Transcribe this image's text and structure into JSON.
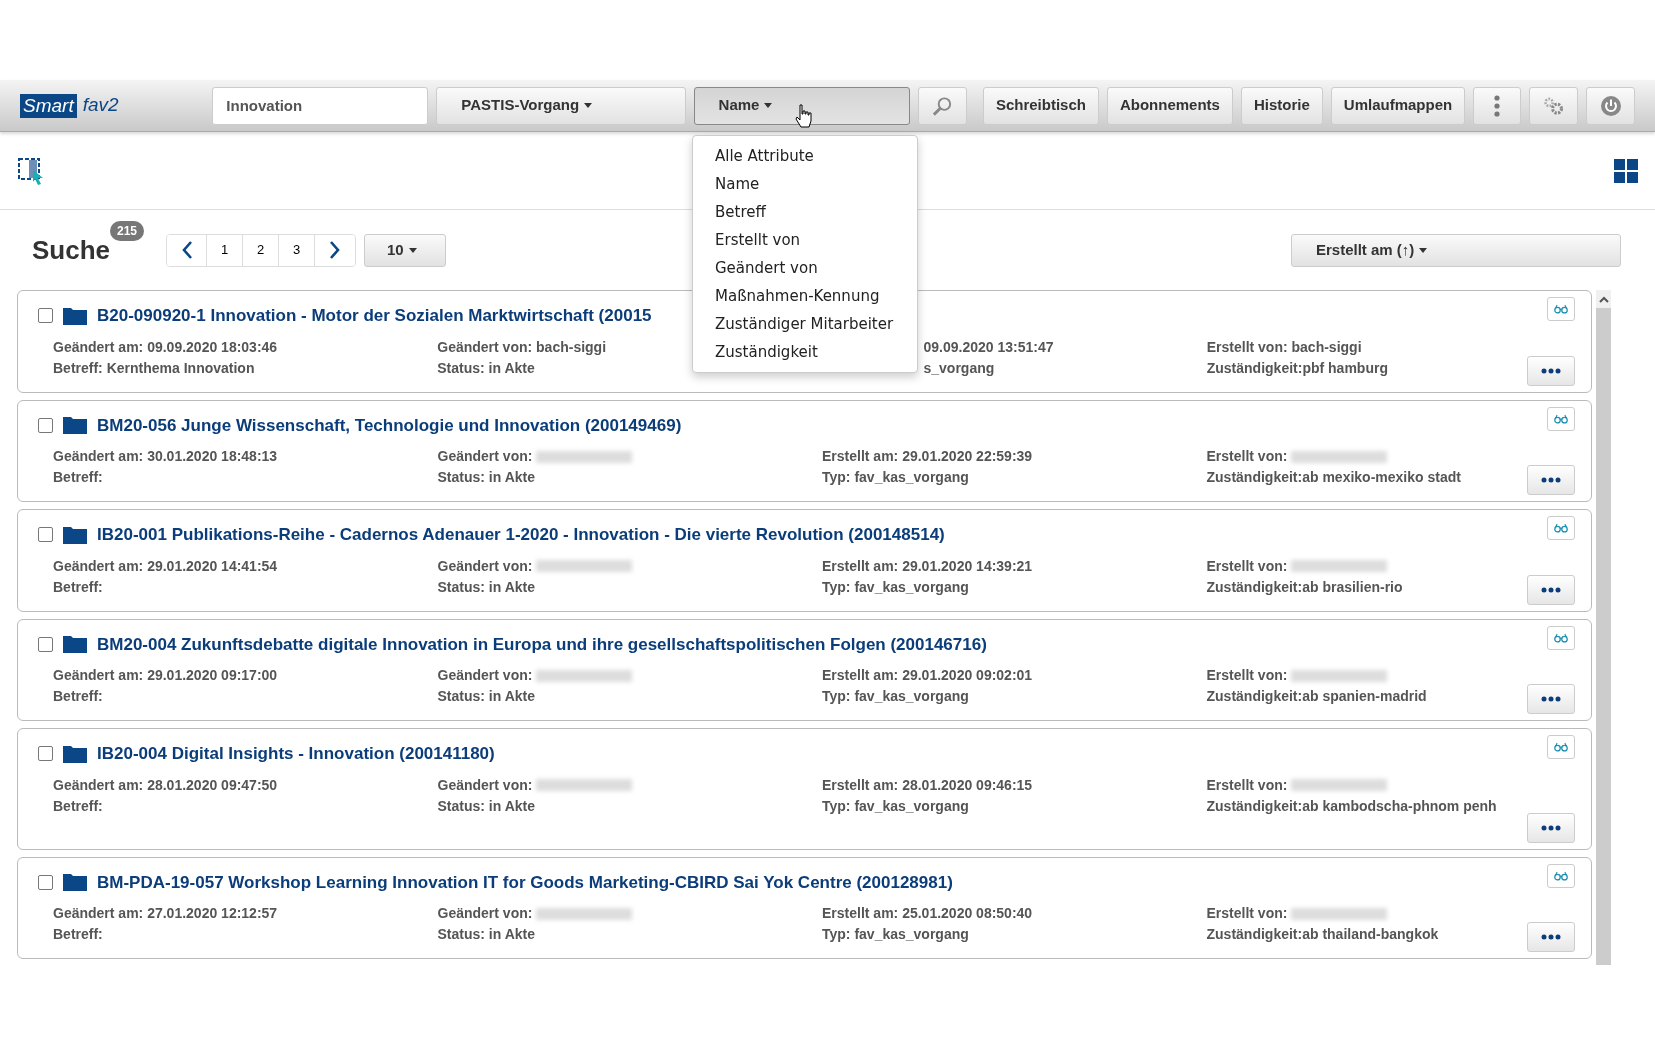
{
  "app": {
    "logo_word": "Smart",
    "logo_suffix": "fav2"
  },
  "toolbar": {
    "search_value": "Innovation",
    "type_dropdown": "PASTIS-Vorgang",
    "field_dropdown": {
      "label": "Name",
      "expanded": true
    },
    "nav_buttons": [
      "Schreibtisch",
      "Abonnements",
      "Historie",
      "Umlaufmappen"
    ]
  },
  "field_menu": {
    "items": [
      "Alle Attribute",
      "Name",
      "Betreff",
      "Erstellt von",
      "Geändert von",
      "Maßnahmen-Kennung",
      "Zuständiger Mitarbeiter",
      "Zuständigkeit"
    ]
  },
  "results_header": {
    "title": "Suche",
    "count": "215",
    "pages": [
      "1",
      "2",
      "3"
    ],
    "page_size": "10",
    "sort": "Erstellt am (↑)"
  },
  "results": [
    {
      "title": "B20-090920-1 Innovation - Motor der Sozialen Marktwirtschaft (20015",
      "checked": false,
      "fields": [
        [
          {
            "label": "Geändert am:",
            "value": "09.09.2020 18:03:46"
          },
          {
            "label": "Betreff:",
            "value": "Kernthema Innovation"
          }
        ],
        [
          {
            "label": "Geändert von:",
            "value": "bach-siggi"
          },
          {
            "label": "Status:",
            "value": "in Akte"
          }
        ],
        [
          {
            "value": "09.09.2020 13:51:47"
          },
          {
            "value": "s_vorgang"
          }
        ],
        [
          {
            "label": "Erstellt von:",
            "value": "bach-siggi"
          },
          {
            "label": "Zuständigkeit:",
            "value": "pbf hamburg"
          }
        ]
      ]
    },
    {
      "title": "BM20-056 Junge Wissenschaft, Technologie und Innovation (200149469)",
      "checked": false,
      "fields": [
        [
          {
            "label": "Geändert am:",
            "value": "30.01.2020 18:48:13"
          },
          {
            "label": "Betreff:"
          }
        ],
        [
          {
            "label": "Geändert von:",
            "redacted": true
          },
          {
            "label": "Status:",
            "value": "in Akte"
          }
        ],
        [
          {
            "label": "Erstellt am:",
            "value": "29.01.2020 22:59:39"
          },
          {
            "label": "Typ:",
            "value": "fav_kas_vorgang"
          }
        ],
        [
          {
            "label": "Erstellt von:",
            "redacted": true
          },
          {
            "label": "Zuständigkeit:",
            "value": "ab mexiko-mexiko stadt"
          }
        ]
      ]
    },
    {
      "title": "IB20-001 Publikations-Reihe - Cadernos Adenauer 1-2020 - Innovation - Die vierte Revolution (200148514)",
      "checked": false,
      "fields": [
        [
          {
            "label": "Geändert am:",
            "value": "29.01.2020 14:41:54"
          },
          {
            "label": "Betreff:"
          }
        ],
        [
          {
            "label": "Geändert von:",
            "redacted": true
          },
          {
            "label": "Status:",
            "value": "in Akte"
          }
        ],
        [
          {
            "label": "Erstellt am:",
            "value": "29.01.2020 14:39:21"
          },
          {
            "label": "Typ:",
            "value": "fav_kas_vorgang"
          }
        ],
        [
          {
            "label": "Erstellt von:",
            "redacted": true
          },
          {
            "label": "Zuständigkeit:",
            "value": "ab brasilien-rio"
          }
        ]
      ]
    },
    {
      "title": "BM20-004 Zukunftsdebatte digitale Innovation in Europa und ihre gesellschaftspolitischen Folgen (200146716)",
      "checked": false,
      "fields": [
        [
          {
            "label": "Geändert am:",
            "value": "29.01.2020 09:17:00"
          },
          {
            "label": "Betreff:"
          }
        ],
        [
          {
            "label": "Geändert von:",
            "redacted": true
          },
          {
            "label": "Status:",
            "value": "in Akte"
          }
        ],
        [
          {
            "label": "Erstellt am:",
            "value": "29.01.2020 09:02:01"
          },
          {
            "label": "Typ:",
            "value": "fav_kas_vorgang"
          }
        ],
        [
          {
            "label": "Erstellt von:",
            "redacted": true
          },
          {
            "label": "Zuständigkeit:",
            "value": "ab spanien-madrid"
          }
        ]
      ]
    },
    {
      "title": "IB20-004 Digital Insights - Innovation (200141180)",
      "checked": false,
      "fields": [
        [
          {
            "label": "Geändert am:",
            "value": "28.01.2020 09:47:50"
          },
          {
            "label": "Betreff:"
          }
        ],
        [
          {
            "label": "Geändert von:",
            "redacted": true
          },
          {
            "label": "Status:",
            "value": "in Akte"
          }
        ],
        [
          {
            "label": "Erstellt am:",
            "value": "28.01.2020 09:46:15"
          },
          {
            "label": "Typ:",
            "value": "fav_kas_vorgang"
          }
        ],
        [
          {
            "label": "Erstellt von:",
            "redacted": true
          },
          {
            "label": "Zuständigkeit:",
            "value": "ab kambodscha-phnom penh"
          }
        ]
      ]
    },
    {
      "title": "BM-PDA-19-057 Workshop Learning Innovation IT for Goods Marketing-CBIRD Sai Yok Centre (200128981)",
      "checked": false,
      "fields": [
        [
          {
            "label": "Geändert am:",
            "value": "27.01.2020 12:12:57"
          },
          {
            "label": "Betreff:"
          }
        ],
        [
          {
            "label": "Geändert von:",
            "redacted": true
          },
          {
            "label": "Status:",
            "value": "in Akte"
          }
        ],
        [
          {
            "label": "Erstellt am:",
            "value": "25.01.2020 08:50:40"
          },
          {
            "label": "Typ:",
            "value": "fav_kas_vorgang"
          }
        ],
        [
          {
            "label": "Erstellt von:",
            "redacted": true
          },
          {
            "label": "Zuständigkeit:",
            "value": "ab thailand-bangkok"
          }
        ]
      ]
    }
  ]
}
